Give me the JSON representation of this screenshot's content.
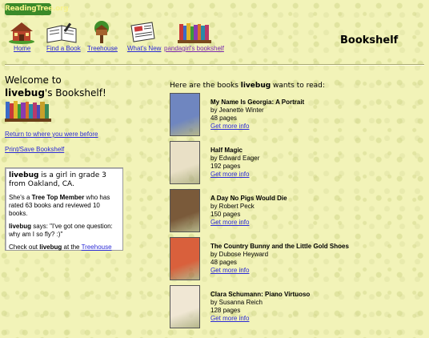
{
  "site": {
    "logo_text": "ReadingTree.org"
  },
  "nav": [
    {
      "label": "Home",
      "icon": "house-icon"
    },
    {
      "label": "Find a Book",
      "icon": "open-book-icon"
    },
    {
      "label": "Treehouse",
      "icon": "treehouse-icon"
    },
    {
      "label": "What's New",
      "icon": "newspaper-icon"
    },
    {
      "label": "pandagirl's bookshelf",
      "icon": "bookshelf-icon"
    }
  ],
  "page_title": "Bookshelf",
  "welcome": {
    "line1": "Welcome to",
    "user": "livebug",
    "line2_suffix": "'s Bookshelf!"
  },
  "links": {
    "return": "Return to where you were before",
    "print": "Print/Save Bookshelf"
  },
  "profile": {
    "user": "livebug",
    "intro": " is a girl in grade 3 from Oakland, CA.",
    "member_prefix": "She's a ",
    "member_level": "Tree Top Member",
    "member_suffix": " who has rated 63 books and reviewed 10 books.",
    "says_user": "livebug",
    "says_text": " says: \"I've got one question: why am I so fly? :)\"",
    "checkout_prefix": "Check out ",
    "checkout_user": "livebug",
    "checkout_mid": " at the ",
    "checkout_link": "Treehouse"
  },
  "books_heading": {
    "prefix": "Here are the books ",
    "user": "livebug",
    "suffix": " wants to read:"
  },
  "books": [
    {
      "title": "My Name Is Georgia: A Portrait",
      "author": "by Jeanette Winter",
      "pages": "48 pages",
      "more": "Get more info",
      "cover_color": "#6f86c0"
    },
    {
      "title": "Half Magic",
      "author": "by Edward Eager",
      "pages": "192 pages",
      "more": "Get more info",
      "cover_color": "#e9e0c6"
    },
    {
      "title": "A Day No Pigs Would Die",
      "author": "by Robert Peck",
      "pages": "150 pages",
      "more": "Get more info",
      "cover_color": "#7a5a3a"
    },
    {
      "title": "The Country Bunny and the Little Gold Shoes",
      "author": "by Dubose Heyward",
      "pages": "48 pages",
      "more": "Get more info",
      "cover_color": "#d9603c"
    },
    {
      "title": "Clara Schumann: Piano Virtuoso",
      "author": "by Susanna Reich",
      "pages": "128 pages",
      "more": "Get more info",
      "cover_color": "#f0e7d4"
    }
  ]
}
